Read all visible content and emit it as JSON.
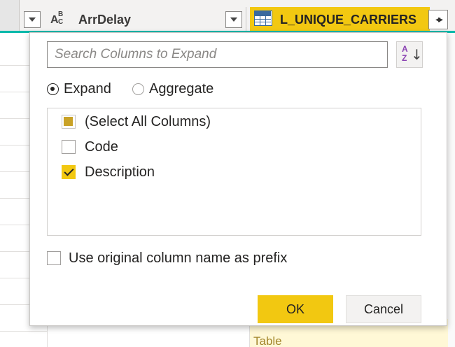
{
  "table_header": {
    "arr_delay_column": {
      "type_icon": "abc-text-type-icon",
      "title": "ArrDelay"
    },
    "carriers_column": {
      "type_icon": "table-icon",
      "title": "L_UNIQUE_CARRIERS",
      "expand_icon": "expand-arrows-icon",
      "accent_color": "#F2C811"
    }
  },
  "grid": {
    "visible_cell_text": "Table"
  },
  "expand_popup": {
    "search": {
      "placeholder": "Search Columns to Expand",
      "value": ""
    },
    "sort_button": {
      "icon": "sort-az-icon",
      "label_a": "A",
      "label_z": "Z"
    },
    "mode_options": [
      {
        "label": "Expand",
        "selected": true
      },
      {
        "label": "Aggregate",
        "selected": false
      }
    ],
    "columns": [
      {
        "label": "(Select All Columns)",
        "state": "indeterminate"
      },
      {
        "label": "Code",
        "state": "unchecked"
      },
      {
        "label": "Description",
        "state": "checked"
      }
    ],
    "prefix_option": {
      "label": "Use original column name as prefix",
      "checked": false
    },
    "ok_label": "OK",
    "cancel_label": "Cancel"
  },
  "colors": {
    "accent": "#F2C811",
    "header_divider": "#01B8AA"
  }
}
